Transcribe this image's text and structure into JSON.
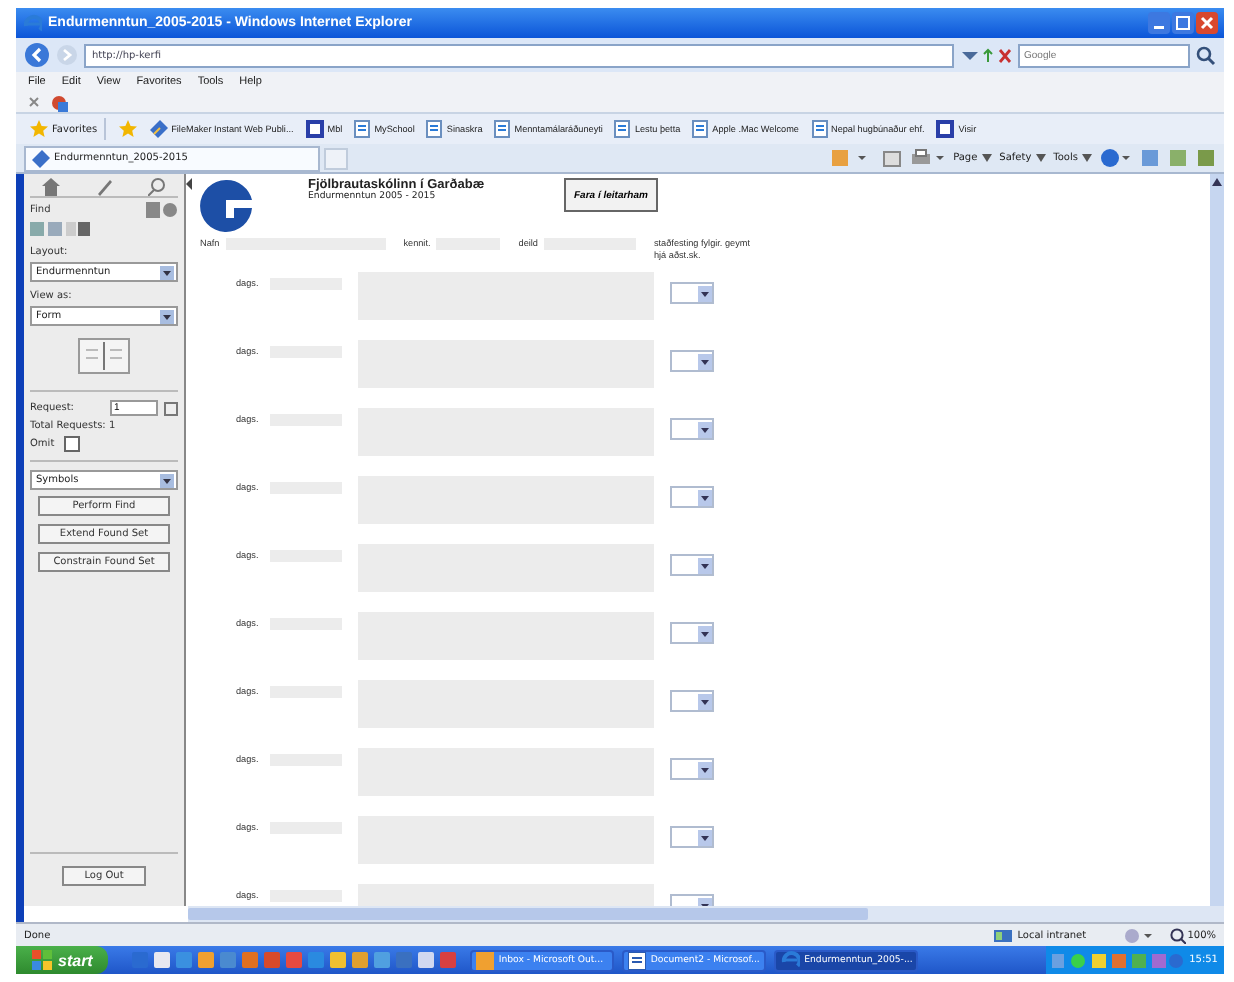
{
  "window": {
    "title": "Endurmenntun_2005-2015 - Windows Internet Explorer"
  },
  "address_bar": {
    "url": "http://hp-kerfi",
    "search_placeholder": "Google"
  },
  "menu": [
    "File",
    "Edit",
    "View",
    "Favorites",
    "Tools",
    "Help"
  ],
  "favorites_bar": {
    "label": "Favorites",
    "items": [
      {
        "label": "FileMaker Instant Web Publi...",
        "kind": "filemaker"
      },
      {
        "label": "Mbl",
        "kind": "site"
      },
      {
        "label": "MySchool",
        "kind": "page"
      },
      {
        "label": "Sinaskra",
        "kind": "page"
      },
      {
        "label": "Menntamálaráðuneyti",
        "kind": "page"
      },
      {
        "label": "Lestu þetta",
        "kind": "page"
      },
      {
        "label": "Apple .Mac Welcome",
        "kind": "page"
      },
      {
        "label": "Nepal hugbúnaður ehf.",
        "kind": "page"
      },
      {
        "label": "Visir",
        "kind": "site"
      }
    ]
  },
  "tab": {
    "label": "Endurmenntun_2005-2015"
  },
  "command_bar": [
    "Page",
    "Safety",
    "Tools"
  ],
  "sidebar": {
    "mode": "Find",
    "layout_label": "Layout:",
    "layout": "Endurmenntun",
    "view_label": "View as:",
    "view": "Form",
    "request_label": "Request:",
    "request": "1",
    "total_requests": "Total Requests: 1",
    "omit_label": "Omit",
    "omit": false,
    "symbols": "Symbols",
    "buttons": [
      "Perform Find",
      "Extend Found Set",
      "Constrain Found Set"
    ],
    "logout": "Log Out"
  },
  "form": {
    "school": "Fjölbrautaskólinn í Garðabæ",
    "subtitle": "Endurmenntun 2005 - 2015",
    "find_button": "Fara í leitarham",
    "fields": [
      {
        "label": "Nafn",
        "kind": "wide"
      },
      {
        "label": "kennit.",
        "kind": "short"
      },
      {
        "label": "deild",
        "kind": "medium"
      }
    ],
    "confirm_label": "staðfesting fylgir. geymt hjá aðst.sk.",
    "rows": [
      {
        "label": "dags."
      },
      {
        "label": "dags."
      },
      {
        "label": "dags."
      },
      {
        "label": "dags."
      },
      {
        "label": "dags."
      },
      {
        "label": "dags."
      },
      {
        "label": "dags."
      },
      {
        "label": "dags."
      },
      {
        "label": "dags."
      },
      {
        "label": "dags."
      }
    ]
  },
  "status_bar": {
    "text": "Done",
    "zone": "Local intranet",
    "zoom": "100%"
  },
  "taskbar": {
    "start": "start",
    "tasks": [
      {
        "label": "Inbox - Microsoft Out...",
        "selected": false,
        "kind": "mail"
      },
      {
        "label": "Document2 - Microsof...",
        "selected": false,
        "kind": "doc"
      },
      {
        "label": "Endurmenntun_2005-...",
        "selected": true,
        "kind": "ie"
      }
    ],
    "clock": "15:51"
  }
}
